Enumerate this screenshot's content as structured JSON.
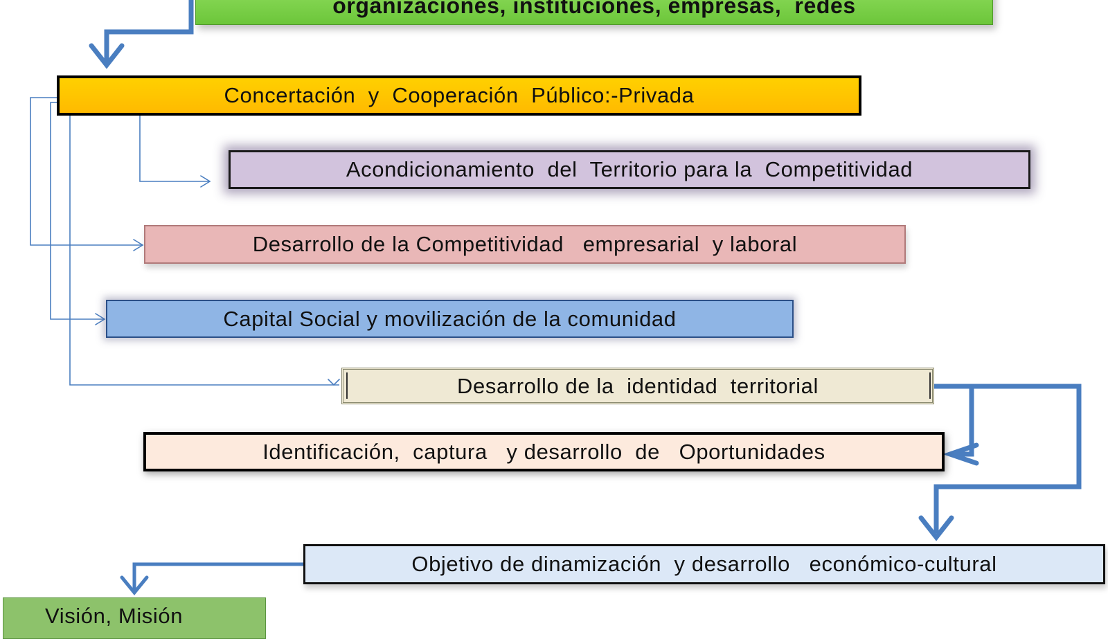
{
  "diagram": {
    "nodes": [
      {
        "id": "n0",
        "label": "organizaciones, instituciones, empresas,  redes",
        "fill": "#7ed348"
      },
      {
        "id": "n1",
        "label": "Concertación  y  Cooperación  Público:-Privada",
        "fill": "#ffc400"
      },
      {
        "id": "n2",
        "label": "Acondicionamiento  del  Territorio para la  Competitividad",
        "fill": "#d2c3dd"
      },
      {
        "id": "n3",
        "label": "Desarrollo de la Competitividad   empresarial  y laboral",
        "fill": "#e9b7b7"
      },
      {
        "id": "n4",
        "label": "Capital Social y movilización de la comunidad",
        "fill": "#8fb5e5"
      },
      {
        "id": "n5",
        "label": "Desarrollo de la  identidad  territorial",
        "fill": "#efe9d4"
      },
      {
        "id": "n6",
        "label": "Identificación,  captura   y desarrollo  de   Oportunidades",
        "fill": "#fdeadd"
      },
      {
        "id": "n7",
        "label": "Objetivo de dinamización  y desarrollo   económico-cultural",
        "fill": "#dce8f7"
      },
      {
        "id": "n8",
        "label": "Visión, Misión",
        "fill": "#8dc26b"
      }
    ],
    "edges": [
      {
        "from": "n0",
        "to": "n1",
        "style": "thick"
      },
      {
        "from": "n1",
        "to": "n2",
        "style": "thin"
      },
      {
        "from": "n1",
        "to": "n3",
        "style": "thin"
      },
      {
        "from": "n1",
        "to": "n4",
        "style": "thin"
      },
      {
        "from": "n1",
        "to": "n5",
        "style": "thin"
      },
      {
        "from": "n5",
        "to": "n6",
        "style": "thick"
      },
      {
        "from": "n5",
        "to": "n7",
        "style": "thick"
      },
      {
        "from": "n7",
        "to": "n8",
        "style": "thick"
      }
    ],
    "arrow_color": "#4a7ec0"
  }
}
